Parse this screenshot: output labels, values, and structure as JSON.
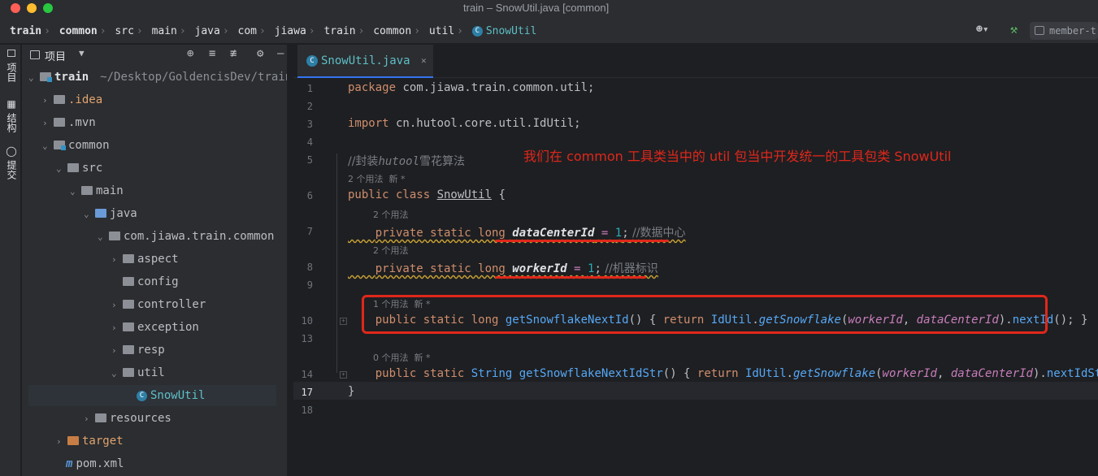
{
  "window": {
    "title": "train – SnowUtil.java [common]"
  },
  "breadcrumbs": [
    "train",
    "common",
    "src",
    "main",
    "java",
    "com",
    "jiawa",
    "train",
    "common",
    "util",
    "SnowUtil"
  ],
  "toolbar": {
    "member_button": "member-t"
  },
  "toolstrip": {
    "project": "项目",
    "structure": "结构",
    "commit": "提交"
  },
  "project": {
    "title": "项目",
    "tree": [
      {
        "label": "train",
        "path": "~/Desktop/GoldencisDev/train"
      },
      {
        "label": ".idea"
      },
      {
        "label": ".mvn"
      },
      {
        "label": "common"
      },
      {
        "label": "src"
      },
      {
        "label": "main"
      },
      {
        "label": "java"
      },
      {
        "label": "com.jiawa.train.common"
      },
      {
        "label": "aspect"
      },
      {
        "label": "config"
      },
      {
        "label": "controller"
      },
      {
        "label": "exception"
      },
      {
        "label": "resp"
      },
      {
        "label": "util"
      },
      {
        "label": "SnowUtil"
      },
      {
        "label": "resources"
      },
      {
        "label": "target"
      },
      {
        "label": "pom.xml"
      }
    ]
  },
  "editor": {
    "tab": "SnowUtil.java",
    "line_numbers": [
      "1",
      "2",
      "3",
      "4",
      "5",
      "6",
      "7",
      "8",
      "9",
      "10",
      "13",
      "14",
      "17",
      "18"
    ],
    "code": {
      "l1_kw": "package",
      "l1_rest": " com.jiawa.train.common.util;",
      "l3_kw": "import",
      "l3_rest": " cn.hutool.core.util.IdUtil;",
      "l5_comment_a": "//封装",
      "l5_comment_b": "hutool",
      "l5_comment_c": "雪花算法",
      "hint_class": "2 个用法  新 *",
      "l6_kw": "public class ",
      "l6_cls": "SnowUtil",
      "l6_brace": " {",
      "hint_f1": "2 个用法",
      "l7_kw": "private static long ",
      "l7_field": "dataCenterId",
      "l7_eq": " = ",
      "l7_num": "1",
      "l7_semi": ";",
      "l7_cmt": " //数据中心",
      "hint_f2": "2 个用法",
      "l8_kw": "private static long ",
      "l8_field": "workerId",
      "l8_eq": " = ",
      "l8_num": "1",
      "l8_semi": ";",
      "l8_cmt": " //机器标识",
      "hint_m1": "1 个用法  新 *",
      "l10_kw": "public static long ",
      "l10_name": "getSnowflakeNextId",
      "l10_a": "() { ",
      "l10_ret": "return ",
      "l10_util": "IdUtil",
      "l10_dot": ".",
      "l10_call": "getSnowflake",
      "l10_p1": "(",
      "l10_w": "workerId",
      "l10_c": ", ",
      "l10_d": "dataCenterId",
      "l10_p2": ").",
      "l10_next": "nextId",
      "l10_end": "(); }",
      "hint_m2": "0 个用法  新 *",
      "l14_kw": "public static ",
      "l14_type": "String ",
      "l14_name": "getSnowflakeNextIdStr",
      "l14_a": "() { ",
      "l14_ret": "return ",
      "l14_util": "IdUtil",
      "l14_dot": ".",
      "l14_call": "getSnowflake",
      "l14_p1": "(",
      "l14_w": "workerId",
      "l14_c": ", ",
      "l14_d": "dataCenterId",
      "l14_p2": ").",
      "l14_next": "nextIdStr",
      "l14_end": "(); }",
      "l17": "}"
    }
  },
  "annotation": {
    "text": "我们在 common 工具类当中的 util 包当中开发统一的工具包类 SnowUtil"
  },
  "colors": {
    "annotation": "#e0271b",
    "accent": "#3574f0",
    "keyword": "#cf8e6d",
    "field": "#c77dbb",
    "method": "#56a8f5"
  }
}
